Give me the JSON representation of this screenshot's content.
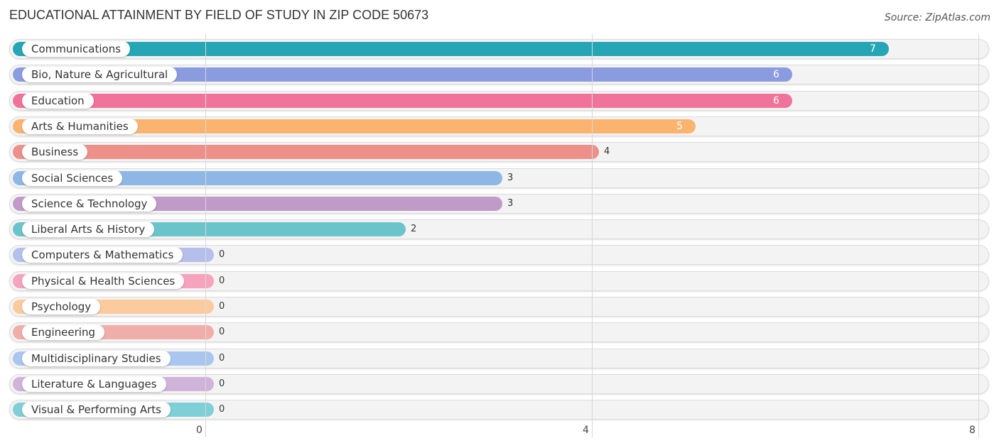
{
  "title": "EDUCATIONAL ATTAINMENT BY FIELD OF STUDY IN ZIP CODE 50673",
  "source": "Source: ZipAtlas.com",
  "chart_data": {
    "type": "bar",
    "orientation": "horizontal",
    "title": "EDUCATIONAL ATTAINMENT BY FIELD OF STUDY IN ZIP CODE 50673",
    "xlabel": "",
    "ylabel": "",
    "xlim": [
      0,
      8
    ],
    "xticks": [
      "0",
      "4",
      "8"
    ],
    "grid": true,
    "categories": [
      "Communications",
      "Bio, Nature & Agricultural",
      "Education",
      "Arts & Humanities",
      "Business",
      "Social Sciences",
      "Science & Technology",
      "Liberal Arts & History",
      "Computers & Mathematics",
      "Physical & Health Sciences",
      "Psychology",
      "Engineering",
      "Multidisciplinary Studies",
      "Literature & Languages",
      "Visual & Performing Arts"
    ],
    "values": [
      7,
      6,
      6,
      5,
      4,
      3,
      3,
      2,
      0,
      0,
      0,
      0,
      0,
      0,
      0
    ],
    "colors": [
      "#26a5b5",
      "#8a9be0",
      "#f0739b",
      "#fbb470",
      "#ec9089",
      "#8fb7e6",
      "#c09bc8",
      "#6cc4cb",
      "#b4bfec",
      "#f6a3bd",
      "#fbcb9e",
      "#f0aeab",
      "#a9c7ee",
      "#cfb3d8",
      "#7fcfd6"
    ]
  }
}
